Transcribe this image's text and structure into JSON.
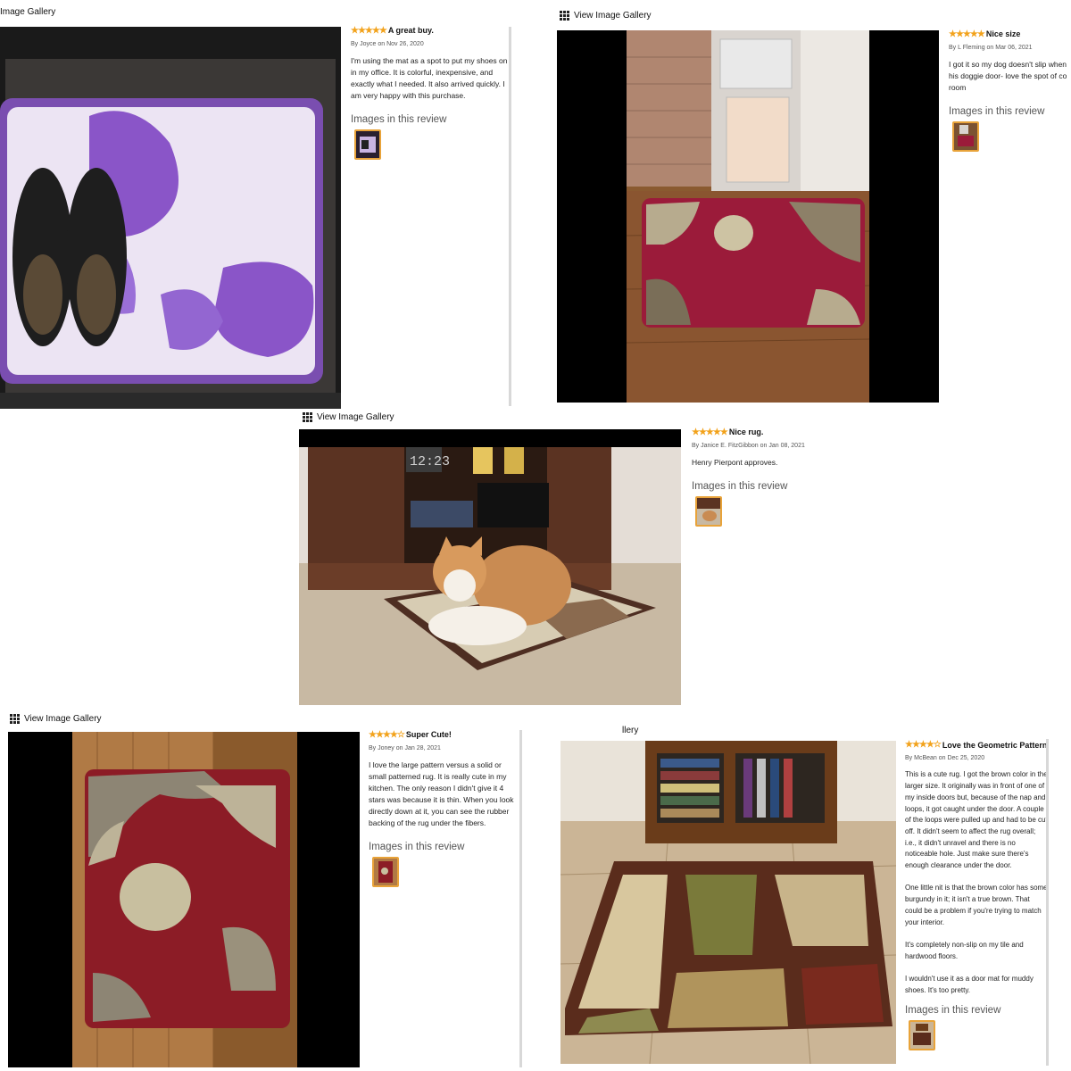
{
  "gallery_label": "View Image Gallery",
  "reviews": [
    {
      "stars": "★★★★★",
      "title": "A great buy.",
      "byline": "By Joyce on Nov 26, 2020",
      "text": "I'm using the mat as a spot to put my shoes on in my office. It is colorful, inexpensive, and exactly what I needed. It also arrived quickly. I am very happy with this purchase.",
      "images_label": "Images in this review"
    },
    {
      "stars": "★★★★★",
      "title": "Nice size",
      "byline": "By L Fleming on Mar 06, 2021",
      "text": "I got it so my dog doesn't slip when his doggie door- love the spot of co room",
      "images_label": "Images in this review"
    },
    {
      "stars": "★★★★★",
      "title": "Nice rug.",
      "byline": "By Janice E. FitzGibbon on Jan 08, 2021",
      "text": "Henry Pierpont approves.",
      "images_label": "Images in this review"
    },
    {
      "stars": "★★★★☆",
      "title": "Super Cute!",
      "byline": "By Joney on Jan 28, 2021",
      "text": "I love the large pattern versus a solid or small patterned rug. It is really cute in my kitchen. The only reason I didn't give it 4 stars was because it is thin. When you look directly down at it, you can see the rubber backing of the rug under the fibers.",
      "images_label": "Images in this review"
    },
    {
      "stars": "★★★★☆",
      "title": "Love the Geometric Pattern",
      "byline": "By McBean on Dec 25, 2020",
      "text": "This is a cute rug. I got the brown color in the larger size. It originally was in front of one of my inside doors but, because of the nap and loops, it got caught under the door. A couple of the loops were pulled up and had to be cut off. It didn't seem to affect the rug overall; i.e., it didn't unravel and there is no noticeable hole. Just make sure there's enough clearance under the door.\n\nOne little nit is that the brown color has some burgundy in it; it isn't a true brown. That could be a problem if you're trying to match your interior.\n\nIt's completely non-slip on my tile and hardwood floors.\n\nI wouldn't use it as a door mat for muddy shoes. It's too pretty.",
      "images_label": "Images in this review"
    }
  ],
  "clock_reading": "12:23",
  "partial_labels": {
    "top_left": "Image Gallery",
    "bottom_right": "llery"
  },
  "colors": {
    "star": "#f2a21b",
    "thumb_border": "#e8a33a"
  }
}
